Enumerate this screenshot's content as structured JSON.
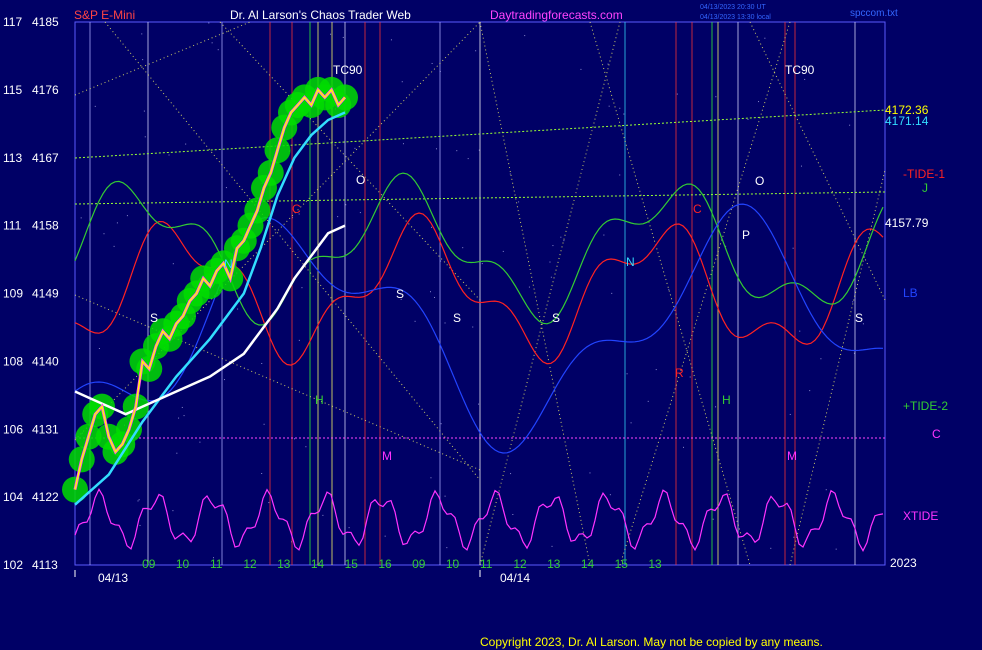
{
  "header": {
    "instrument": "S&P E-Mini",
    "site": "Dr. Al Larson's Chaos Trader Web",
    "url": "Daytradingforecasts.com",
    "stamp1": "04/13/2023 20:30 UT",
    "stamp2": "04/13/2023 13:30 local",
    "file": "spccom.txt"
  },
  "footer": {
    "copyright": "Copyright 2023, Dr. Al Larson. May not be copied by any means."
  },
  "colors": {
    "background": "#000066",
    "plot_border": "#5a5aff",
    "price": "#ffff00",
    "glow": "#00dd00",
    "ma_fast": "#33ddff",
    "ma_slow": "#ffffff",
    "tide1": "#ff2222",
    "tide2": "#33cc33",
    "xtide": "#ff33ff",
    "lb": "#2244ff"
  },
  "chart_data": {
    "type": "line",
    "title": "S&P E-Mini",
    "y_left_ticks": [
      {
        "left": "117",
        "right": "4185",
        "value": 4185
      },
      {
        "left": "115",
        "right": "4176",
        "value": 4176
      },
      {
        "left": "113",
        "right": "4167",
        "value": 4167
      },
      {
        "left": "111",
        "right": "4158",
        "value": 4158
      },
      {
        "left": "109",
        "right": "4149",
        "value": 4149
      },
      {
        "left": "108",
        "right": "4140",
        "value": 4140
      },
      {
        "left": "106",
        "right": "4131",
        "value": 4131
      },
      {
        "left": "104",
        "right": "4122",
        "value": 4122
      },
      {
        "left": "102",
        "right": "4113",
        "value": 4113
      }
    ],
    "ylim": [
      4113,
      4185
    ],
    "xlim": [
      8.0,
      32.0
    ],
    "x_ticks": [
      {
        "label": "09",
        "x": 9
      },
      {
        "label": "10",
        "x": 10
      },
      {
        "label": "11",
        "x": 11
      },
      {
        "label": "12",
        "x": 12
      },
      {
        "label": "13",
        "x": 13
      },
      {
        "label": "14",
        "x": 14
      },
      {
        "label": "15",
        "x": 15
      },
      {
        "label": "16",
        "x": 16
      },
      {
        "label": "09",
        "x": 17
      },
      {
        "label": "10",
        "x": 18
      },
      {
        "label": "11",
        "x": 19
      },
      {
        "label": "12",
        "x": 20
      },
      {
        "label": "13",
        "x": 21
      },
      {
        "label": "14",
        "x": 22
      },
      {
        "label": "15",
        "x": 23
      },
      {
        "label": "13",
        "x": 24
      }
    ],
    "dates": [
      {
        "label": "04/13",
        "x": 8.6
      },
      {
        "label": "04/14",
        "x": 16.7
      }
    ],
    "year_label": "2023",
    "series": [
      {
        "name": "price",
        "x": [
          8.0,
          8.2,
          8.4,
          8.6,
          8.8,
          9.0,
          9.2,
          9.4,
          9.6,
          9.8,
          10.0,
          10.2,
          10.4,
          10.6,
          10.8,
          11.0,
          11.2,
          11.4,
          11.6,
          11.8,
          12.0,
          12.2,
          12.4,
          12.6,
          12.8,
          13.0,
          13.2,
          13.4,
          13.6,
          13.8,
          14.0,
          14.2,
          14.4,
          14.6,
          14.8,
          15.0,
          15.2,
          15.4,
          15.6,
          15.8,
          16.0
        ],
        "values": [
          4123,
          4127,
          4130,
          4133,
          4134,
          4130,
          4128,
          4129,
          4131,
          4134,
          4140,
          4139,
          4142,
          4144,
          4143,
          4145,
          4146,
          4148,
          4149,
          4151,
          4150,
          4152,
          4153,
          4151,
          4155,
          4156,
          4158,
          4160,
          4163,
          4165,
          4168,
          4171,
          4173,
          4174,
          4175,
          4174,
          4176,
          4175,
          4176,
          4174,
          4175
        ]
      },
      {
        "name": "ma_fast",
        "x": [
          8.0,
          9.0,
          10.0,
          11.0,
          12.0,
          13.0,
          13.5,
          14.0,
          14.5,
          15.0,
          15.5,
          16.0
        ],
        "values": [
          4121,
          4125,
          4132,
          4138,
          4143,
          4149,
          4155,
          4162,
          4167,
          4170,
          4172,
          4173
        ]
      },
      {
        "name": "ma_slow",
        "x": [
          8.0,
          8.5,
          9.0,
          9.5,
          10.0,
          11.0,
          12.0,
          13.0,
          13.5,
          14.0,
          14.5,
          15.0,
          15.5,
          16.0
        ],
        "values": [
          4136,
          4135,
          4134,
          4133,
          4134,
          4136,
          4138,
          4141,
          4144,
          4147,
          4151,
          4154,
          4157,
          4158
        ]
      }
    ],
    "right_labels": [
      {
        "text": "4172.36",
        "color": "#ffff00"
      },
      {
        "text": "4171.14",
        "color": "#33ddff"
      },
      {
        "text": "-TIDE-1",
        "color": "#ff2222"
      },
      {
        "text": "J",
        "color": "#33cc33"
      },
      {
        "text": "4157.79",
        "color": "#ffffff"
      },
      {
        "text": "LB",
        "color": "#2244ff"
      },
      {
        "text": "+TIDE-2",
        "color": "#33cc33"
      },
      {
        "text": "C",
        "color": "#ff33ff"
      },
      {
        "text": "XTIDE",
        "color": "#ff33ff"
      }
    ],
    "markers": [
      {
        "text": "TC90",
        "color": "#ffffff"
      },
      {
        "text": "TC90",
        "color": "#ffffff"
      },
      {
        "text": "N",
        "color": "#33ddff"
      },
      {
        "text": "N",
        "color": "#33ddff"
      },
      {
        "text": "S",
        "color": "#ffffff"
      },
      {
        "text": "S",
        "color": "#ffffff"
      },
      {
        "text": "S",
        "color": "#ffffff"
      },
      {
        "text": "S",
        "color": "#ffffff"
      },
      {
        "text": "S",
        "color": "#ffffff"
      },
      {
        "text": "C",
        "color": "#ff2222"
      },
      {
        "text": "C",
        "color": "#ff2222"
      },
      {
        "text": "O",
        "color": "#ffffff"
      },
      {
        "text": "O",
        "color": "#ffffff"
      },
      {
        "text": "P",
        "color": "#ffffff"
      },
      {
        "text": "R",
        "color": "#ff2222"
      },
      {
        "text": "H",
        "color": "#33cc33"
      },
      {
        "text": "H",
        "color": "#33cc33"
      },
      {
        "text": "M",
        "color": "#ff33ff"
      },
      {
        "text": "M",
        "color": "#ff33ff"
      }
    ]
  }
}
